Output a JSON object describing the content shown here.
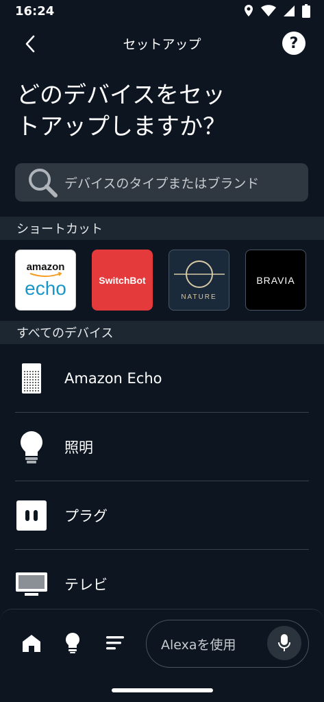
{
  "status_bar": {
    "time": "16:24"
  },
  "header": {
    "title": "セットアップ",
    "help_label": "?"
  },
  "page_title": "どのデバイスをセッ\nトアップしますか？",
  "search": {
    "placeholder": "デバイスのタイプまたはブランド"
  },
  "shortcuts": {
    "section_title": "ショートカット",
    "tiles": [
      {
        "brand_line1": "amazon",
        "brand_line2": "echo"
      },
      {
        "brand": "SwitchBot"
      },
      {
        "brand": "NATURE"
      },
      {
        "brand": "BRAVIA"
      }
    ]
  },
  "all_devices": {
    "section_title": "すべてのデバイス",
    "items": [
      {
        "label": "Amazon Echo",
        "icon": "echo-speaker-icon"
      },
      {
        "label": "照明",
        "icon": "light-bulb-icon"
      },
      {
        "label": "プラグ",
        "icon": "plug-icon"
      },
      {
        "label": "テレビ",
        "icon": "tv-icon"
      }
    ]
  },
  "bottom_nav": {
    "alexa_label": "Alexaを使用",
    "items": [
      "home-icon",
      "devices-bulb-icon",
      "more-menu-icon",
      "microphone-icon"
    ]
  },
  "colors": {
    "background": "#0c1520",
    "section_header": "#1d2732",
    "search_bg": "#2f3840",
    "switchbot_red": "#e53a3c"
  }
}
